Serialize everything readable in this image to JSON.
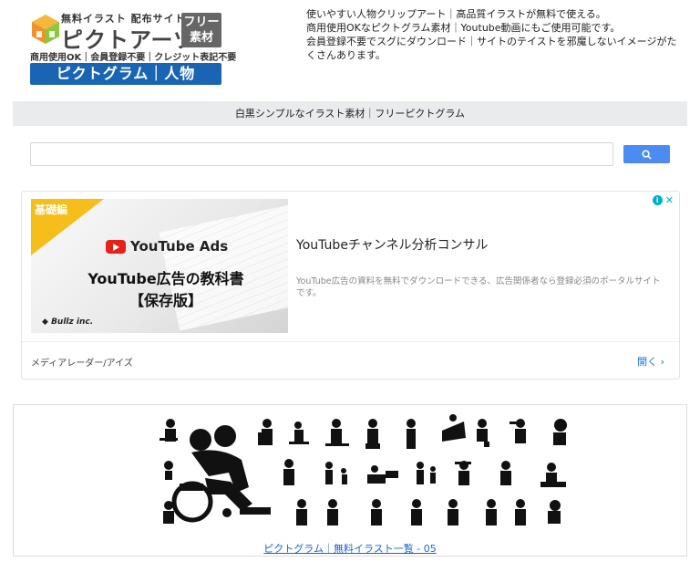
{
  "logo": {
    "small_text": "無料イラスト 配布サイト",
    "big_text": "ピクトアーツ",
    "free_line1": "フリー",
    "free_line2": "素材",
    "tags": "商用使用OK｜会員登録不要｜クレジット表記不要",
    "banner": "ピクトグラム｜人物"
  },
  "description": {
    "line1": "使いやすい人物クリップアート｜高品質イラストが無料で使える。",
    "line2": "商用使用OKなピクトグラム素材｜Youtube動画にもご使用可能です。",
    "line3": "会員登録不要でスグにダウンロード｜サイトのテイストを邪魔しないイメージがたくさんあります。"
  },
  "nav": {
    "text": "白黒シンプルなイラスト素材｜フリーピクトグラム"
  },
  "search": {
    "placeholder": "",
    "button_icon": "search-icon"
  },
  "ad": {
    "corner_label": "基礎編",
    "youtube_ads": "YouTube Ads",
    "book_line1": "YouTube広告の教科書",
    "book_line2": "【保存版】",
    "company": "Bullz inc.",
    "title": "YouTubeチャンネル分析コンサル",
    "description": "YouTube広告の資料を無料でダウンロードできる、広告関係者なら登録必須のポータルサイトです。",
    "advertiser": "メディアレーダー/アイズ",
    "open_label": "開く",
    "colors": {
      "corner": "#f6be1b",
      "link": "#1a73e8",
      "info": "#00aecd"
    }
  },
  "pictogram": {
    "link_text": "ピクトグラム｜無料イラスト一覧 - 05"
  }
}
